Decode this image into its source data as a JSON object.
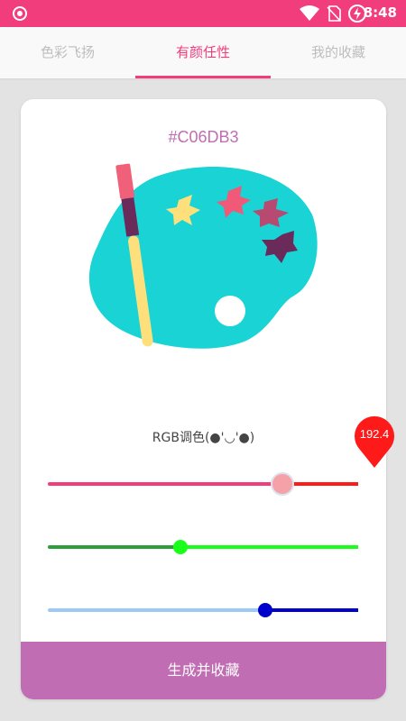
{
  "status_bar": {
    "time": "8:48"
  },
  "tabs": [
    {
      "label": "色彩飞扬",
      "active": false
    },
    {
      "label": "有颜任性",
      "active": true
    },
    {
      "label": "我的收藏",
      "active": false
    }
  ],
  "color": {
    "hex": "#C06DB3"
  },
  "rgb": {
    "label": "RGB调色(●'◡'●)",
    "red": 192.4,
    "red_bubble": "192.4",
    "green": 109,
    "blue": 179,
    "max": 255
  },
  "colors": {
    "accent": "#f23d7c",
    "card_button": "#c06db3",
    "red_track": "#ff1a1a",
    "green_track": "#1aff1a",
    "blue_track": "#0000cc"
  },
  "actions": {
    "generate_label": "生成并收藏"
  }
}
